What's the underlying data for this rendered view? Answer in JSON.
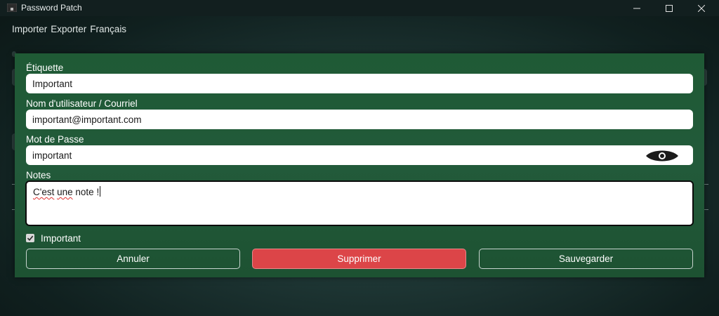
{
  "window": {
    "title": "Password Patch",
    "controls": {
      "minimize": "–",
      "maximize": "□",
      "close": "✕"
    }
  },
  "menu": {
    "items": [
      "Importer",
      "Exporter",
      "Français"
    ]
  },
  "dialog": {
    "label_field": {
      "label": "Étiquette",
      "value": "Important"
    },
    "username_field": {
      "label": "Nom d'utilisateur / Courriel",
      "value": "important@important.com"
    },
    "password_field": {
      "label": "Mot de Passe",
      "value": "important",
      "toggle_icon": "eye-icon"
    },
    "notes_field": {
      "label": "Notes",
      "value_words": [
        "C'est",
        "une",
        "note",
        "!"
      ]
    },
    "important_checkbox": {
      "label": "Important",
      "checked": true
    },
    "buttons": {
      "cancel": "Annuler",
      "delete": "Supprimer",
      "save": "Sauvegarder"
    }
  },
  "colors": {
    "dialog_bg": "#1f5a35",
    "delete_button": "#dc4548",
    "titlebar": "#121f1f"
  }
}
